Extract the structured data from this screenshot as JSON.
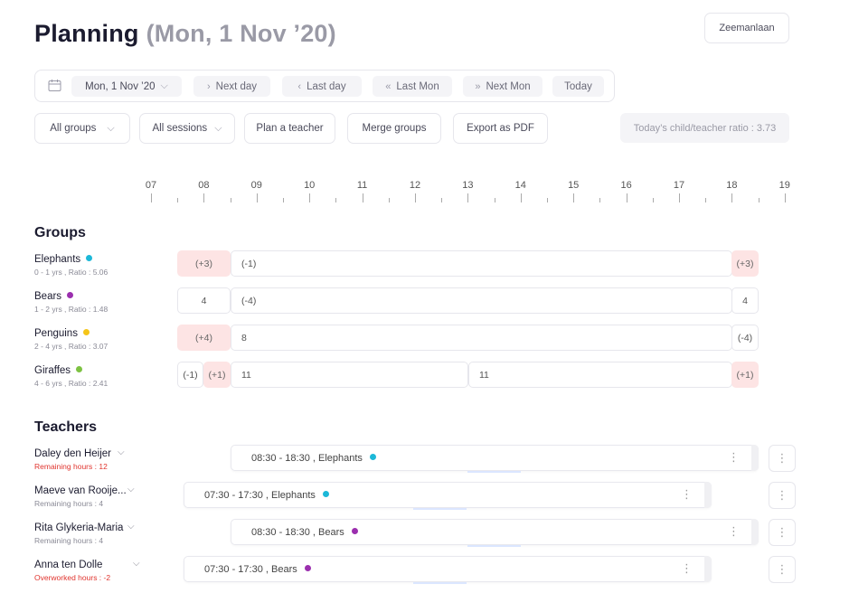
{
  "header": {
    "title": "Planning",
    "subtitle": "(Mon, 1 Nov ’20)",
    "location_button": "Zeemanlaan"
  },
  "date_nav": {
    "date_value": "Mon, 1 Nov ’20",
    "next_day": "Next day",
    "last_day": "Last day",
    "last_mon": "Last Mon",
    "next_mon": "Next Mon",
    "today": "Today"
  },
  "toolbar": {
    "groups_select": "All groups",
    "sessions_select": "All sessions",
    "plan_teacher": "Plan a teacher",
    "merge_groups": "Merge groups",
    "export_pdf": "Export as PDF",
    "ratio_text": "Today’s child/teacher ratio : 3.73"
  },
  "timeline": {
    "hours": [
      "07",
      "08",
      "09",
      "10",
      "11",
      "12",
      "13",
      "14",
      "15",
      "16",
      "17",
      "18",
      "19"
    ]
  },
  "groups": {
    "title": "Groups",
    "items": [
      {
        "name": "Elephants",
        "info": "0 - 1 yrs , Ratio : 5.06",
        "color": "#1cb8d8",
        "bars": [
          "(+3)",
          "(-1)",
          "(+3)"
        ]
      },
      {
        "name": "Bears",
        "info": "1 - 2 yrs , Ratio : 1.48",
        "color": "#9b2fae",
        "bars": [
          "4",
          "(-4)",
          "4"
        ]
      },
      {
        "name": "Penguins",
        "info": "2 - 4 yrs , Ratio : 3.07",
        "color": "#f5c518",
        "bars": [
          "(+4)",
          "8",
          "(-4)"
        ]
      },
      {
        "name": "Giraffes",
        "info": "4 - 6 yrs , Ratio : 2.41",
        "color": "#7dc242",
        "bars": [
          "(-1)",
          "(+1)",
          "11",
          "11",
          "(+1)"
        ]
      }
    ]
  },
  "teachers": {
    "title": "Teachers",
    "items": [
      {
        "name": "Daley den Heijer",
        "hours": "Remaining hours : 12",
        "shift": "08:30 - 18:30 , Elephants",
        "color": "#1cb8d8"
      },
      {
        "name": "Maeve van Rooije...",
        "hours": "Remaining hours : 4",
        "shift": "07:30 - 17:30 , Elephants",
        "color": "#1cb8d8"
      },
      {
        "name": "Rita Glykeria-Maria",
        "hours": "Remaining hours : 4",
        "shift": "08:30 - 18:30 , Bears",
        "color": "#9b2fae"
      },
      {
        "name": "Anna ten Dolle",
        "hours": "Overworked hours : -2",
        "shift": "07:30 - 17:30 , Bears",
        "color": "#9b2fae"
      }
    ]
  }
}
